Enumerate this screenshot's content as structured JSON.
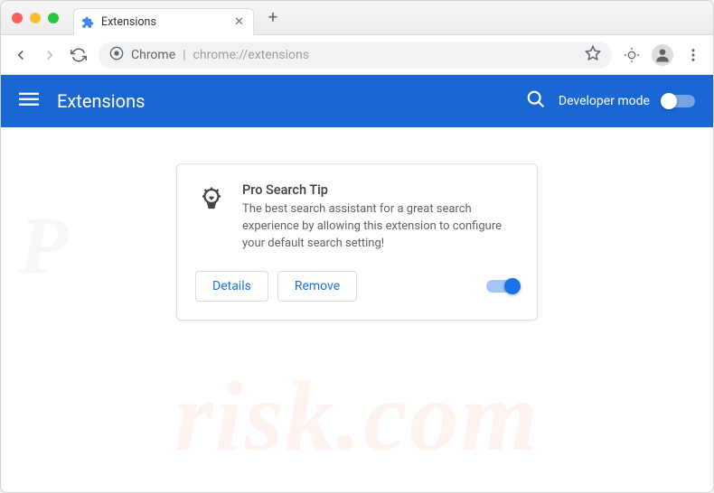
{
  "browser": {
    "tab_title": "Extensions",
    "omnibox": {
      "scheme_label": "Chrome",
      "url": "chrome://extensions"
    }
  },
  "header": {
    "title": "Extensions",
    "developer_mode_label": "Developer mode",
    "developer_mode_on": false
  },
  "extension": {
    "name": "Pro Search Tip",
    "description": "The best search assistant for a great search experience by allowing this extension to configure your default search setting!",
    "enabled": true,
    "buttons": {
      "details": "Details",
      "remove": "Remove"
    }
  },
  "icons": {
    "puzzle": "puzzle-icon",
    "lightbulb": "lightbulb-icon"
  }
}
